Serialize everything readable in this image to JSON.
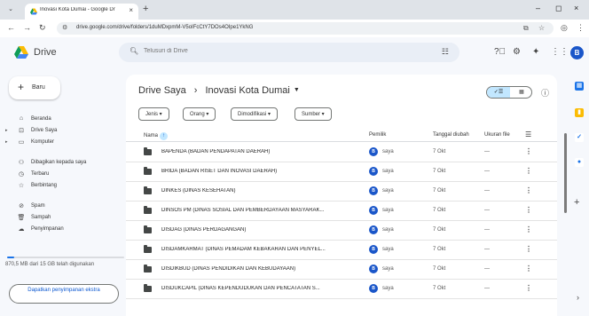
{
  "browser": {
    "tab_title": "Inovasi Kota Dumai - Google Dr",
    "url": "drive.google.com/drive/folders/1duMDxpmM-V5oIFcCtY7DOs4OIpe1YkNG"
  },
  "header": {
    "brand": "Drive",
    "search_placeholder": "Telusuri di Drive",
    "avatar_letter": "B"
  },
  "sidebar": {
    "new_label": "Baru",
    "items": [
      {
        "label": "Beranda",
        "icon": "home-icon"
      },
      {
        "label": "Drive Saya",
        "icon": "drive-icon"
      },
      {
        "label": "Komputer",
        "icon": "computer-icon"
      },
      {
        "label": "Dibagikan kepada saya",
        "icon": "shared-icon"
      },
      {
        "label": "Terbaru",
        "icon": "clock-icon"
      },
      {
        "label": "Berbintang",
        "icon": "star-icon"
      },
      {
        "label": "Spam",
        "icon": "spam-icon"
      },
      {
        "label": "Sampah",
        "icon": "trash-icon"
      },
      {
        "label": "Penyimpanan",
        "icon": "cloud-icon"
      }
    ],
    "storage_text": "870,5 MB dari 15 GB telah digunakan",
    "storage_fraction": 0.058,
    "get_storage_label": "Dapatkan penyimpanan ekstra"
  },
  "main": {
    "breadcrumb_root": "Drive Saya",
    "breadcrumb_sep": "›",
    "breadcrumb_current": "Inovasi Kota Dumai",
    "filters": [
      "Jenis",
      "Orang",
      "Dimodifikasi",
      "Sumber"
    ],
    "columns": {
      "name": "Nama",
      "owner": "Pemilik",
      "date": "Tanggal diubah",
      "size": "Ukuran file"
    },
    "rows": [
      {
        "name": "BAPENDA (BADAN PENDAPATAN DAERAH)",
        "owner": "saya",
        "owner_initial": "B",
        "date": "7 Okt",
        "size": "—"
      },
      {
        "name": "BRIDA (BADAN RISET DAN INOVASI DAERAH)",
        "owner": "saya",
        "owner_initial": "B",
        "date": "7 Okt",
        "size": "—"
      },
      {
        "name": "DINKES (DINAS KESEHATAN)",
        "owner": "saya",
        "owner_initial": "B",
        "date": "7 Okt",
        "size": "—"
      },
      {
        "name": "DINSOS PM (DINAS SOSIAL DAN PEMBERDAYAAN MASYARAK...",
        "owner": "saya",
        "owner_initial": "B",
        "date": "7 Okt",
        "size": "—"
      },
      {
        "name": "DISDAG (DINAS PERDAGANGAN)",
        "owner": "saya",
        "owner_initial": "B",
        "date": "7 Okt",
        "size": "—"
      },
      {
        "name": "DISDAMKARMAT (DINAS PEMADAM KEBAKARAN DAN PENYEL...",
        "owner": "saya",
        "owner_initial": "B",
        "date": "7 Okt",
        "size": "—"
      },
      {
        "name": "DISDIKBUD (DINAS PENDIDIKAN DAN KEBUDAYAAN)",
        "owner": "saya",
        "owner_initial": "B",
        "date": "7 Okt",
        "size": "—"
      },
      {
        "name": "DISDUKCAPIL (DINAS KEPENDUDUKAN DAN PENCATATAN S...",
        "owner": "saya",
        "owner_initial": "B",
        "date": "7 Okt",
        "size": "—"
      }
    ]
  },
  "colors": {
    "accent": "#0b57d0",
    "selected": "#c2e7ff",
    "avatar": "#1a56c9"
  }
}
